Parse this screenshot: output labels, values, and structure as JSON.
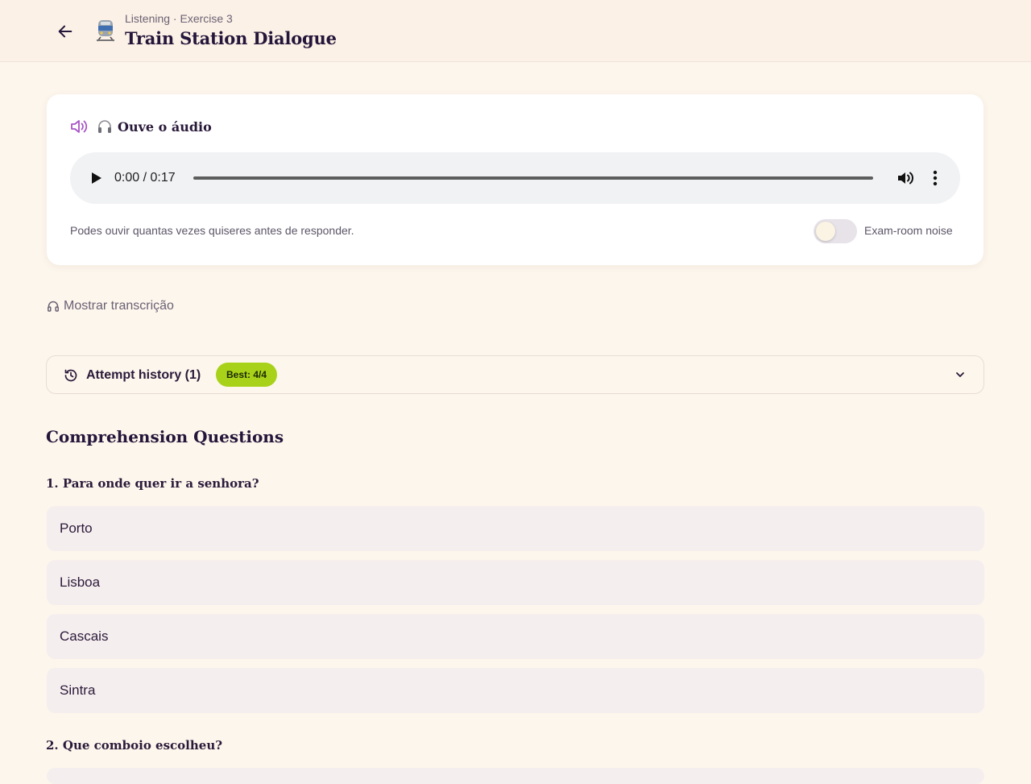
{
  "header": {
    "breadcrumb": "Listening · Exercise 3",
    "title": "Train Station Dialogue"
  },
  "audio": {
    "heading": "Ouve o áudio",
    "time": "0:00 / 0:17",
    "progress": 0,
    "hint": "Podes ouvir quantas vezes quiseres antes de responder.",
    "noise_label": "Exam-room noise",
    "noise_on": false
  },
  "transcript_link": "Mostrar transcrição",
  "history": {
    "label": "Attempt history (1)",
    "badge": "Best: 4/4"
  },
  "questions_title": "Comprehension Questions",
  "questions": [
    {
      "title": "1. Para onde quer ir a senhora?",
      "options": [
        "Porto",
        "Lisboa",
        "Cascais",
        "Sintra"
      ]
    },
    {
      "title": "2. Que comboio escolheu?",
      "options": []
    }
  ],
  "colors": {
    "background": "#fdf6ec",
    "accent": "#a855c7",
    "badge": "#a8d21a",
    "option": "#f5eeee"
  }
}
